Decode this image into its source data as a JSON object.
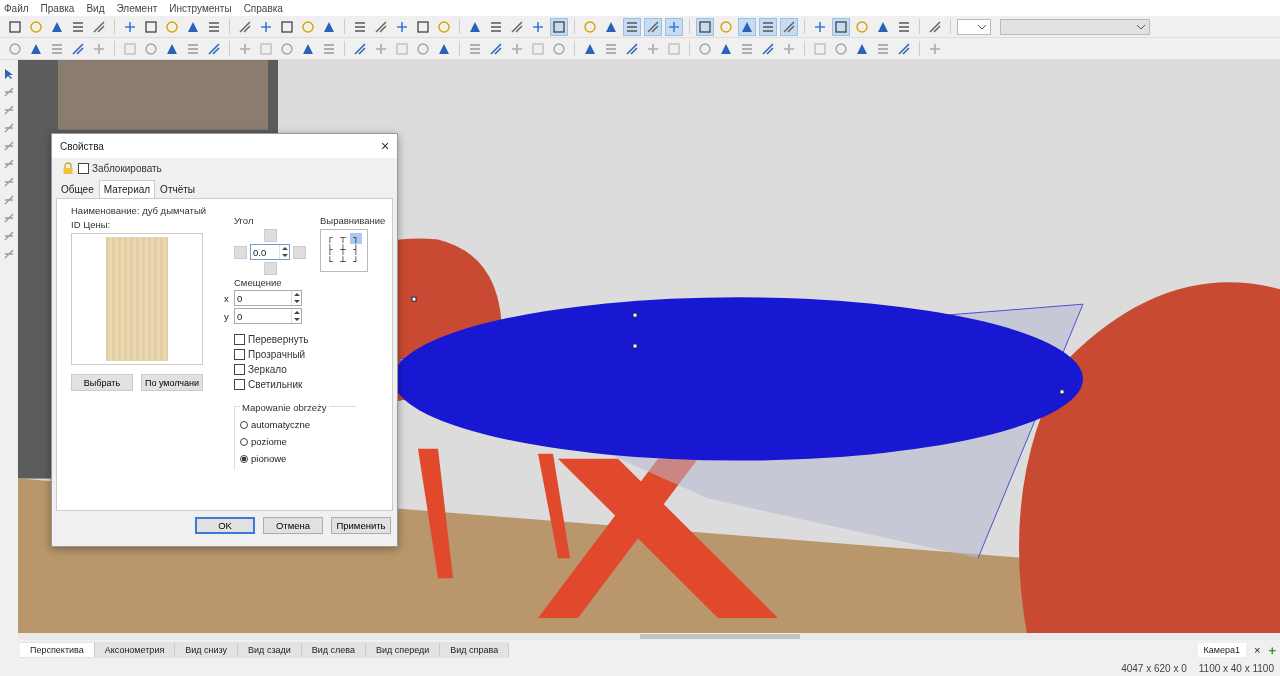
{
  "menu": [
    "Файл",
    "Правка",
    "Вид",
    "Элемент",
    "Инструменты",
    "Справка"
  ],
  "toolbar_top": [
    {
      "pressed": false
    },
    {
      "pressed": false
    },
    {
      "pressed": false
    },
    {
      "pressed": false
    },
    {
      "pressed": false
    },
    {
      "pressed": false
    },
    {
      "pressed": false
    },
    {
      "pressed": false
    },
    {
      "pressed": false
    },
    {
      "pressed": false
    },
    {
      "pressed": false
    },
    {
      "pressed": false
    },
    {
      "pressed": false
    },
    {
      "pressed": false
    },
    {
      "pressed": false
    },
    {
      "pressed": false
    },
    {
      "pressed": false
    },
    {
      "pressed": false
    },
    {
      "pressed": false
    },
    {
      "pressed": false
    },
    {
      "pressed": false
    },
    {
      "pressed": false
    },
    {
      "pressed": false
    },
    {
      "pressed": false
    },
    {
      "pressed": true
    },
    {
      "pressed": false
    },
    {
      "pressed": false
    },
    {
      "pressed": true
    },
    {
      "pressed": true
    },
    {
      "pressed": true
    },
    {
      "pressed": true
    },
    {
      "pressed": false
    },
    {
      "pressed": true
    },
    {
      "pressed": true
    },
    {
      "pressed": true
    },
    {
      "pressed": false
    },
    {
      "pressed": true
    },
    {
      "pressed": false
    },
    {
      "pressed": false
    },
    {
      "pressed": false
    },
    {
      "pressed": false
    }
  ],
  "toolbar_bottom": [
    {
      "pressed": false
    },
    {
      "pressed": false
    },
    {
      "pressed": false
    },
    {
      "pressed": false
    },
    {
      "pressed": false
    },
    {
      "pressed": false
    },
    {
      "pressed": false
    },
    {
      "pressed": false
    },
    {
      "pressed": false
    },
    {
      "pressed": false
    },
    {
      "pressed": false
    },
    {
      "pressed": false
    },
    {
      "pressed": false
    },
    {
      "pressed": false
    },
    {
      "pressed": false
    },
    {
      "pressed": false
    },
    {
      "pressed": false
    },
    {
      "pressed": false
    },
    {
      "pressed": false
    },
    {
      "pressed": false
    },
    {
      "pressed": false
    },
    {
      "pressed": false
    },
    {
      "pressed": false
    },
    {
      "pressed": false
    },
    {
      "pressed": false
    },
    {
      "pressed": false
    },
    {
      "pressed": false
    },
    {
      "pressed": false
    },
    {
      "pressed": false
    },
    {
      "pressed": false
    },
    {
      "pressed": false
    },
    {
      "pressed": false
    },
    {
      "pressed": false
    },
    {
      "pressed": false
    },
    {
      "pressed": false
    },
    {
      "pressed": false
    },
    {
      "pressed": false
    },
    {
      "pressed": false
    },
    {
      "pressed": false
    },
    {
      "pressed": false
    },
    {
      "pressed": false
    }
  ],
  "dialog": {
    "title": "Свойства",
    "close": "×",
    "lock": {
      "label": "Заблокировать",
      "checked": false
    },
    "tabs": [
      {
        "label": "Общее",
        "selected": false
      },
      {
        "label": "Материал",
        "selected": true
      },
      {
        "label": "Отчёты",
        "selected": false
      }
    ],
    "name_label": "Наименование: дуб дымчатый",
    "price_label": "ID Цены:",
    "texture_buttons": [
      "Выбрать",
      "По умолчани"
    ],
    "angle": {
      "label": "Угол",
      "value": "0.0"
    },
    "alignment": {
      "label": "Выравнивание",
      "cells": [
        {
          "symbol": "┌",
          "selected": false
        },
        {
          "symbol": "┬",
          "selected": false
        },
        {
          "symbol": "┐",
          "selected": true
        },
        {
          "symbol": "├",
          "selected": false
        },
        {
          "symbol": "┼",
          "selected": false
        },
        {
          "symbol": "┤",
          "selected": false
        },
        {
          "symbol": "└",
          "selected": false
        },
        {
          "symbol": "┴",
          "selected": false
        },
        {
          "symbol": "┘",
          "selected": false
        }
      ]
    },
    "offset": {
      "label": "Смещение",
      "fields": [
        {
          "axis": "x",
          "value": "0"
        },
        {
          "axis": "y",
          "value": "0"
        }
      ]
    },
    "options": [
      {
        "label": "Перевернуть",
        "checked": false
      },
      {
        "label": "Прозрачный",
        "checked": false
      },
      {
        "label": "Зеркало",
        "checked": false
      },
      {
        "label": "Светильник",
        "checked": false
      }
    ],
    "mapping": {
      "title": "Mapowanie obrzeży",
      "options": [
        {
          "label": "automatyczne",
          "selected": false
        },
        {
          "label": "poziome",
          "selected": false
        },
        {
          "label": "pionowe",
          "selected": true
        }
      ]
    },
    "buttons": [
      "OK",
      "Отмена",
      "Применить"
    ]
  },
  "view_tabs": [
    {
      "label": "Перспектива",
      "selected": true
    },
    {
      "label": "Аксонометрия",
      "selected": false
    },
    {
      "label": "Вид снизу",
      "selected": false
    },
    {
      "label": "Вид сзади",
      "selected": false
    },
    {
      "label": "Вид слева",
      "selected": false
    },
    {
      "label": "Вид спереди",
      "selected": false
    },
    {
      "label": "Вид справа",
      "selected": false
    }
  ],
  "camera_tab": {
    "label": "Камера1",
    "close": "×",
    "add": "+"
  },
  "status_bar": {
    "room_size": "4047 x 620 x 0",
    "element_size": "1100 x 40 x 1100"
  }
}
